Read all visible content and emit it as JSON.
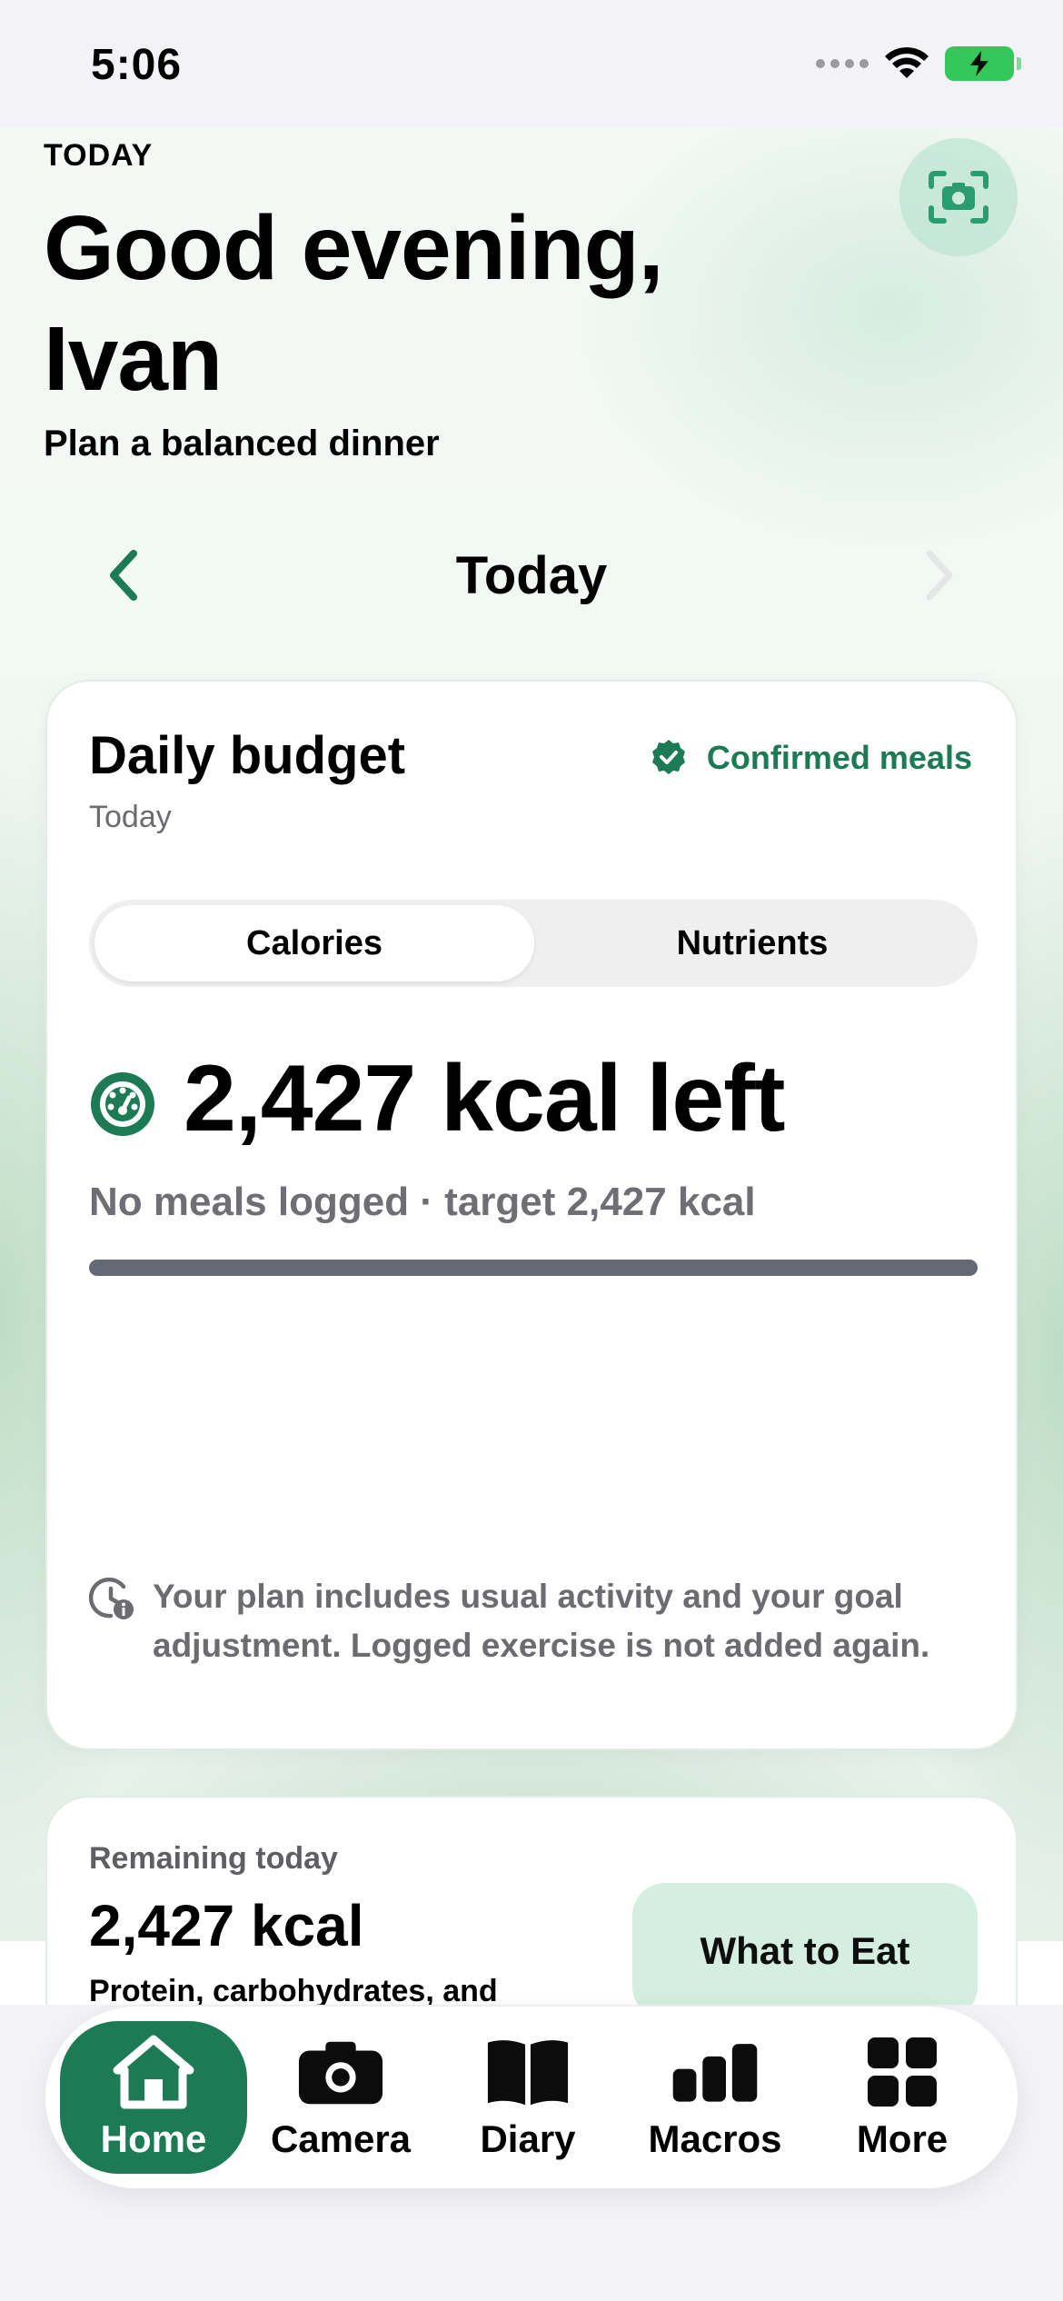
{
  "status_bar": {
    "time": "5:06"
  },
  "header": {
    "eyebrow": "TODAY",
    "greeting": "Good evening, Ivan",
    "subtitle": "Plan a balanced dinner"
  },
  "day_nav": {
    "title": "Today"
  },
  "budget_card": {
    "title": "Daily budget",
    "subtitle": "Today",
    "confirmed_label": "Confirmed meals",
    "segments": [
      "Calories",
      "Nutrients"
    ],
    "selected_segment": "Calories",
    "kcal_left": "2,427 kcal left",
    "meta": "No meals logged · target 2,427 kcal",
    "progress": 0,
    "info": "Your plan includes usual activity and your goal adjustment. Logged exercise is not added again."
  },
  "remaining_card": {
    "label": "Remaining today",
    "value": "2,427 kcal",
    "description": "Protein, carbohydrates, and",
    "button_label": "What to Eat"
  },
  "tabs": [
    {
      "label": "Home",
      "icon": "home-icon",
      "active": true
    },
    {
      "label": "Camera",
      "icon": "camera-icon",
      "active": false
    },
    {
      "label": "Diary",
      "icon": "book-icon",
      "active": false
    },
    {
      "label": "Macros",
      "icon": "bar-chart-icon",
      "active": false
    },
    {
      "label": "More",
      "icon": "grid-icon",
      "active": false
    }
  ],
  "colors": {
    "accent": "#1c7a55",
    "accent_light": "#d4eee2",
    "progress_track": "#646a74",
    "muted_text": "#6e6e74"
  }
}
